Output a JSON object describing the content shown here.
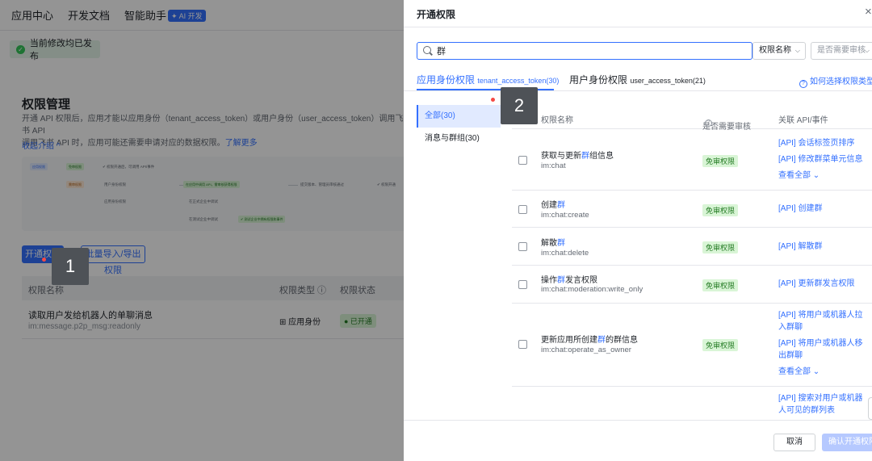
{
  "nav": {
    "items": [
      "应用中心",
      "开发文档",
      "智能助手"
    ],
    "ai_badge": "✦ AI 开发"
  },
  "banner": {
    "text": "当前修改均已发布"
  },
  "permissions_page": {
    "title": "权限管理",
    "desc_line1": "开通 API 权限后，应用才能以应用身份（tenant_access_token）或用户身份（user_access_token）调用飞书 API",
    "desc_line2": "调用飞书 API 时，应用可能还需要申请对应的数据权限。",
    "learn_more": "了解更多",
    "collapse": "收起介绍 ^",
    "open_button": "开通权限",
    "import_button": "批量导入/导出权限",
    "table_headers": [
      "权限名称",
      "权限类型 ⓘ",
      "权限状态"
    ],
    "row": {
      "name": "读取用户发给机器人的单聊消息",
      "scope": "im:message.p2p_msg:readonly",
      "type": "⊞ 应用身份",
      "status": "● 已开通"
    },
    "diagram": {
      "chip1": "应用权限",
      "chip2": "免审权限",
      "chip3": "需审权限",
      "text1": "✔ 权限开通后，可调用 API/事件",
      "text2": "用户身份权限",
      "text3": "在应用中调用 API，需审核获得权限",
      "text4": "提交版本、管理员审核通过",
      "text5": "✔ 权限开通",
      "text6": "应用身份权限",
      "text7": "在正式企业中调试",
      "text8": "在测试企业中调试",
      "text9": "✔ 测试企业中拥有权限和事件"
    }
  },
  "markers": {
    "one": "1",
    "two": "2"
  },
  "drawer": {
    "title": "开通权限",
    "close": "×",
    "search_value": "群",
    "filter_name": "权限名称",
    "filter_review": "是否需要审核",
    "tabs": [
      {
        "label": "应用身份权限",
        "sub": "tenant_access_token",
        "count": "(30)"
      },
      {
        "label": "用户身份权限",
        "sub": "user_access_token",
        "count": "(21)"
      }
    ],
    "help": "如何选择权限类型?",
    "categories": [
      "全部(30)",
      "消息与群组(30)"
    ],
    "headers": {
      "name": "权限名称",
      "review": "是否需要审核",
      "api": "关联 API/事件"
    },
    "rows": [
      {
        "name_pre": "获取与更新",
        "name_hl": "群",
        "name_post": "组信息",
        "scope": "im:chat",
        "tag": "免审权限",
        "apis": [
          "[API] 会话标签页排序",
          "[API] 修改群菜单元信息",
          "查看全部 ⌄"
        ]
      },
      {
        "name_pre": "创建",
        "name_hl": "群",
        "name_post": "",
        "scope": "im:chat:create",
        "tag": "免审权限",
        "apis": [
          "[API] 创建群"
        ]
      },
      {
        "name_pre": "解散",
        "name_hl": "群",
        "name_post": "",
        "scope": "im:chat:delete",
        "tag": "免审权限",
        "apis": [
          "[API] 解散群"
        ]
      },
      {
        "name_pre": "操作",
        "name_hl": "群",
        "name_post": "发言权限",
        "scope": "im:chat:moderation:write_only",
        "tag": "免审权限",
        "apis": [
          "[API] 更新群发言权限"
        ]
      },
      {
        "name_pre": "更新应用所创建",
        "name_hl": "群",
        "name_post": "的群信息",
        "scope": "im:chat:operate_as_owner",
        "tag": "免审权限",
        "apis": [
          "[API] 将用户或机器人拉入群聊",
          "[API] 将用户或机器人移出群聊",
          "查看全部 ⌄"
        ]
      },
      {
        "apis": [
          "[API] 搜索对用户或机器人可见的群列表"
        ]
      }
    ],
    "cancel": "取消",
    "confirm": "确认开通权限"
  },
  "colors": {
    "accent": "#3370ff",
    "success": "#237b23",
    "success_bg": "#d9f5d6"
  }
}
